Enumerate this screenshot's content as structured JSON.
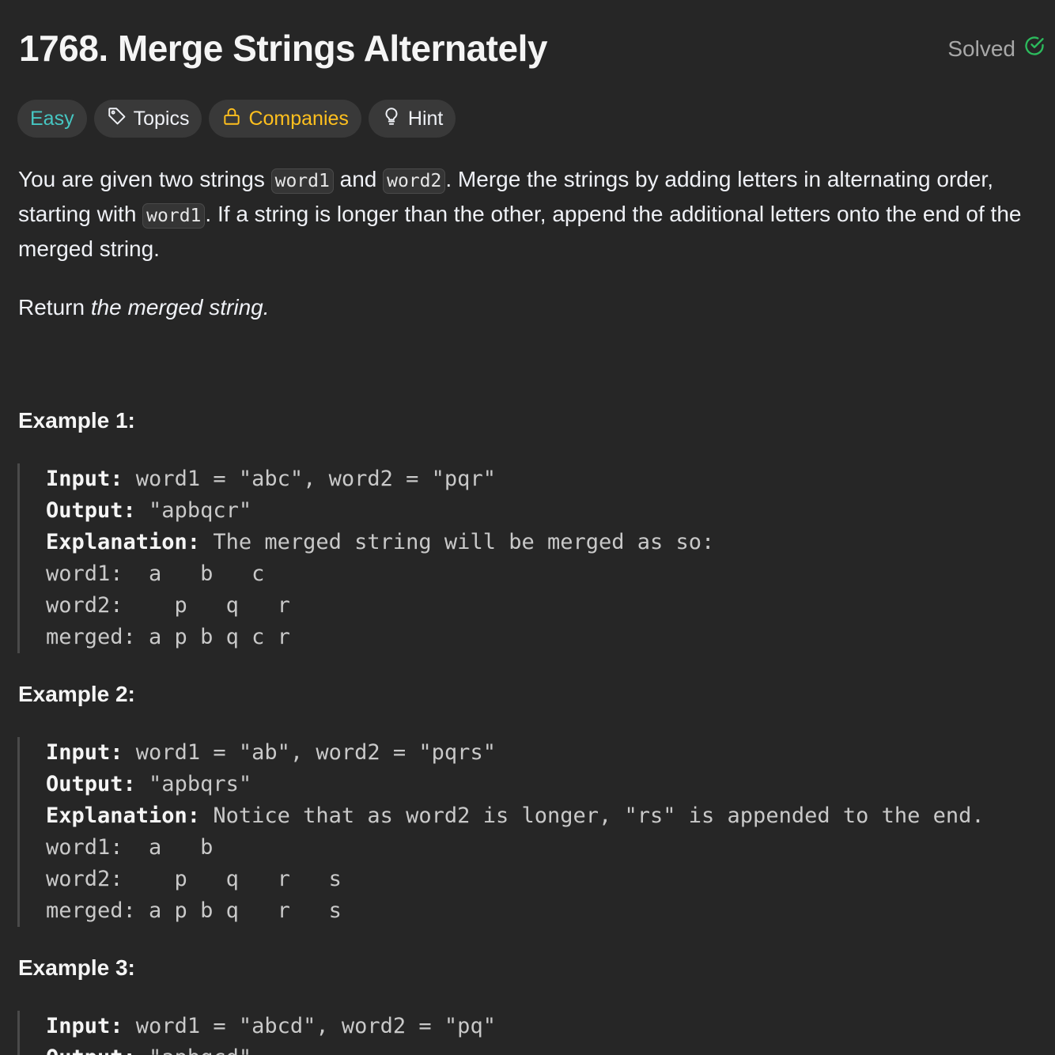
{
  "problem": {
    "title": "1768. Merge Strings Alternately",
    "status": "Solved"
  },
  "tags": {
    "difficulty": "Easy",
    "topics": "Topics",
    "companies": "Companies",
    "hint": "Hint"
  },
  "description": {
    "p1_a": "You are given two strings ",
    "code_word1": "word1",
    "p1_b": " and ",
    "code_word2": "word2",
    "p1_c": ". Merge the strings by adding letters in alternating order, starting with ",
    "p1_d": ". If a string is longer than the other, append the additional letters onto the end of the merged string.",
    "p2_a": "Return ",
    "p2_em": "the merged string",
    "p2_b": "."
  },
  "examples": [
    {
      "title": "Example 1:",
      "input_label": "Input:",
      "input": " word1 = \"abc\", word2 = \"pqr\"",
      "output_label": "Output:",
      "output": " \"apbqcr\"",
      "explanation_label": "Explanation:",
      "explanation": " The merged string will be merged as so:",
      "lines": [
        "word1:  a   b   c",
        "word2:    p   q   r",
        "merged: a p b q c r"
      ]
    },
    {
      "title": "Example 2:",
      "input_label": "Input:",
      "input": " word1 = \"ab\", word2 = \"pqrs\"",
      "output_label": "Output:",
      "output": " \"apbqrs\"",
      "explanation_label": "Explanation:",
      "explanation": " Notice that as word2 is longer, \"rs\" is appended to the end.",
      "lines": [
        "word1:  a   b",
        "word2:    p   q   r   s",
        "merged: a p b q   r   s"
      ]
    },
    {
      "title": "Example 3:",
      "input_label": "Input:",
      "input": " word1 = \"abcd\", word2 = \"pq\"",
      "output_label": "Output:",
      "output": " \"apbqcd\""
    }
  ]
}
